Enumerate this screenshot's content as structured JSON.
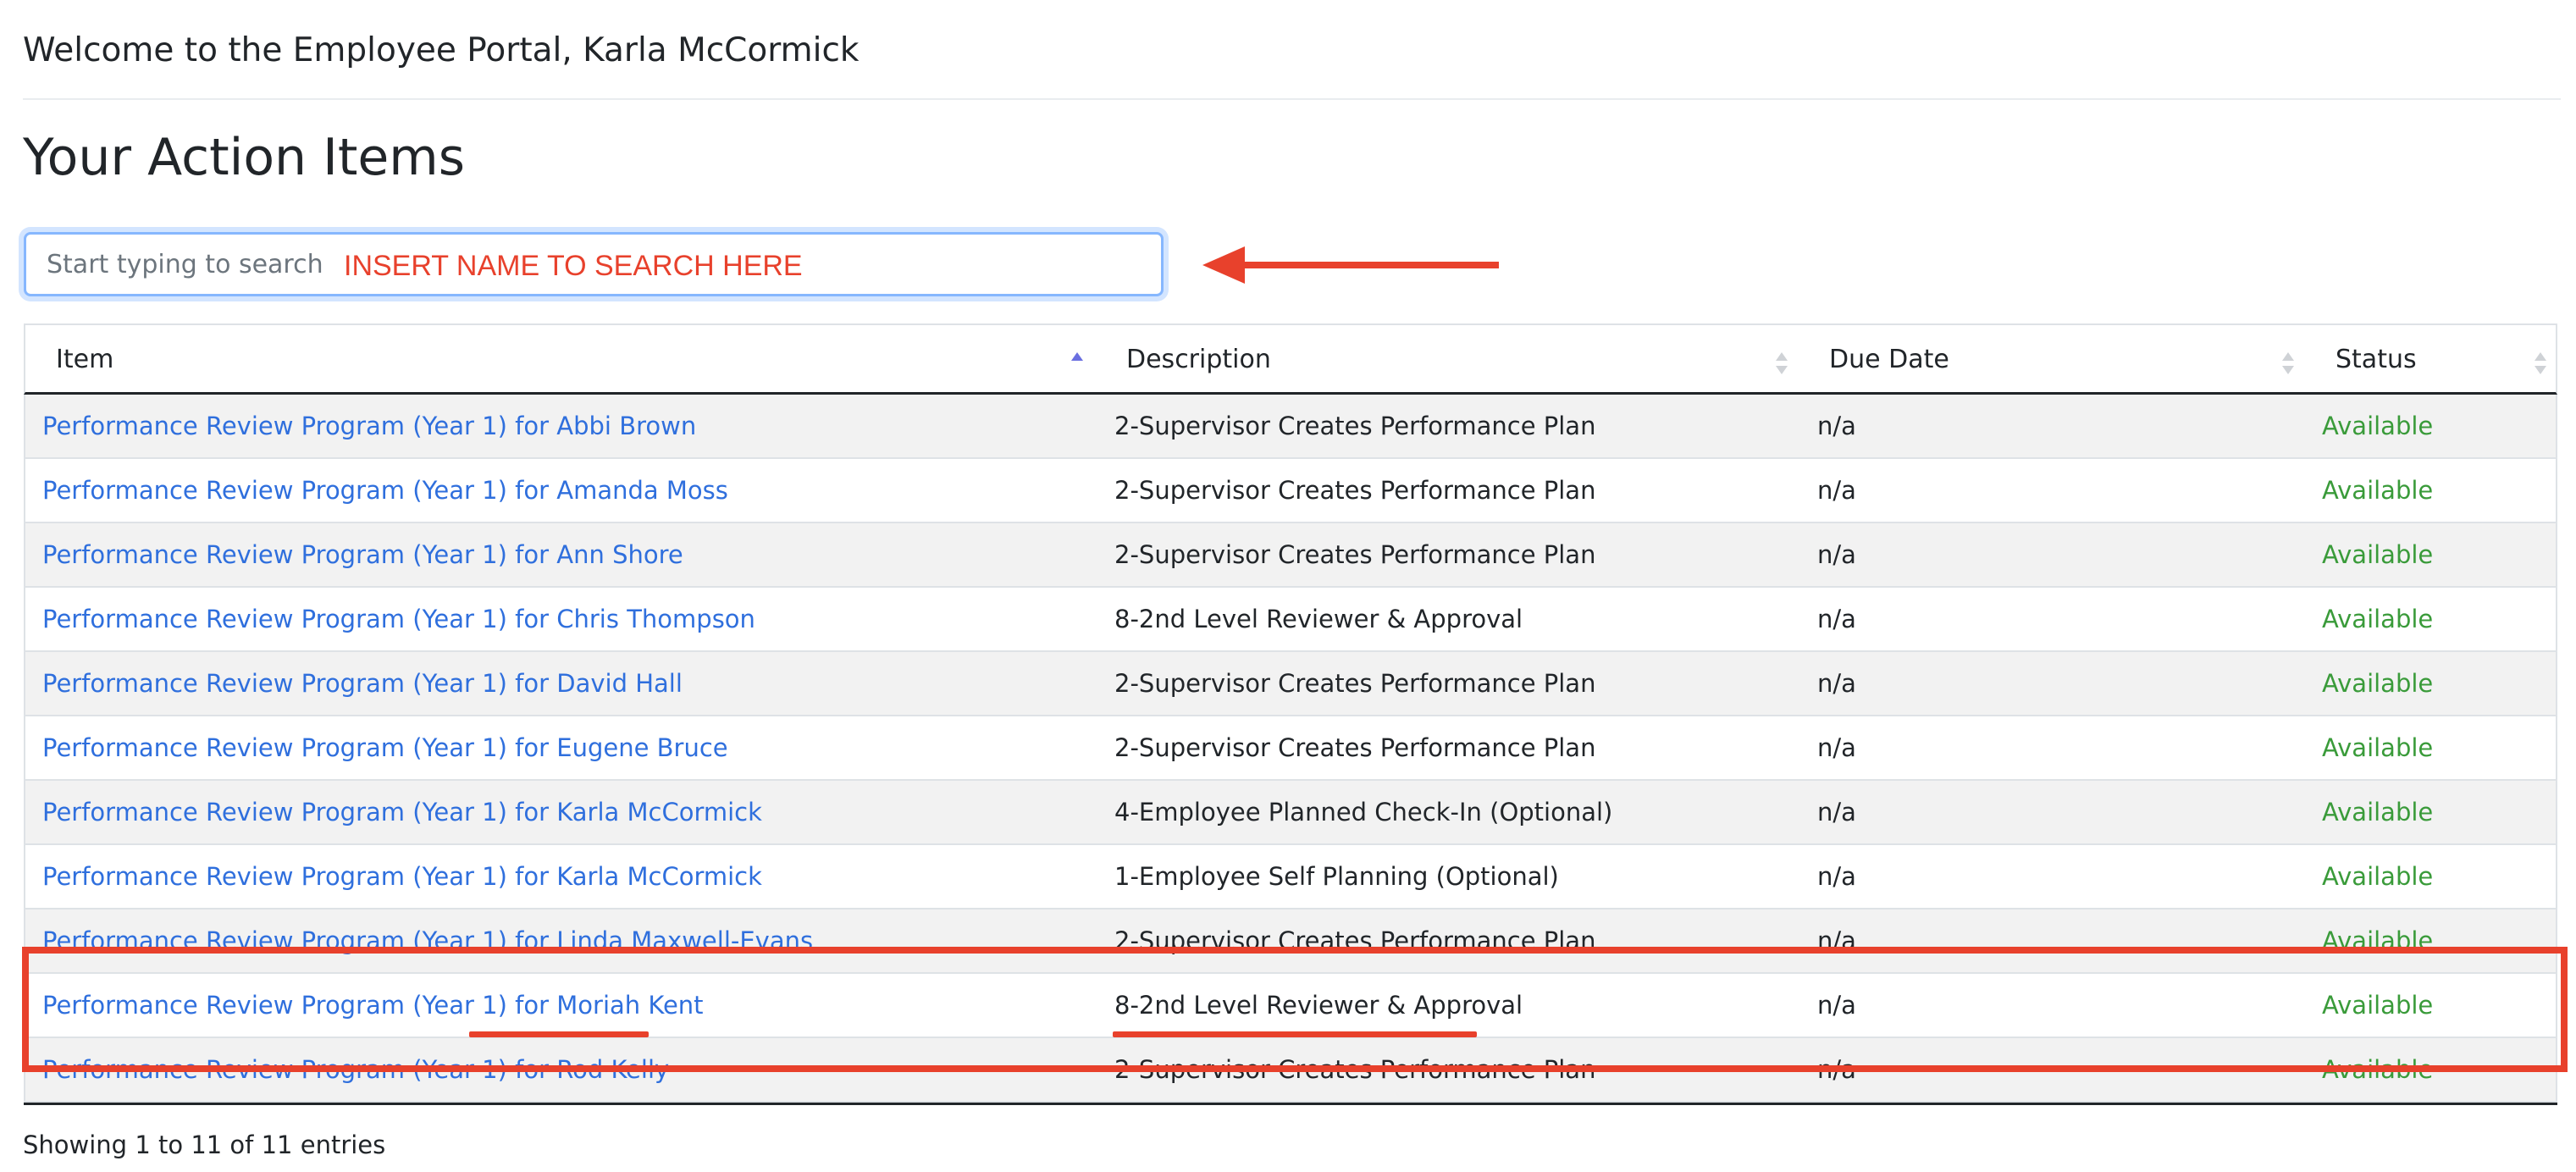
{
  "header": {
    "welcome": "Welcome to the Employee Portal, Karla McCormick",
    "page_title": "Your Action Items"
  },
  "search": {
    "placeholder": "Start typing to search",
    "value": ""
  },
  "annotation": {
    "note": "INSERT NAME TO SEARCH HERE",
    "color": "#e8412c"
  },
  "table": {
    "columns": [
      "Item",
      "Description",
      "Due Date",
      "Status"
    ],
    "sorted_column": "Item",
    "sort_direction": "asc",
    "rows": [
      {
        "item": "Performance Review Program (Year 1) for Abbi Brown",
        "description": "2-Supervisor Creates Performance Plan",
        "due": "n/a",
        "status": "Available"
      },
      {
        "item": "Performance Review Program (Year 1) for Amanda Moss",
        "description": "2-Supervisor Creates Performance Plan",
        "due": "n/a",
        "status": "Available"
      },
      {
        "item": "Performance Review Program (Year 1) for Ann Shore",
        "description": "2-Supervisor Creates Performance Plan",
        "due": "n/a",
        "status": "Available"
      },
      {
        "item": "Performance Review Program (Year 1) for Chris Thompson",
        "description": "8-2nd Level Reviewer & Approval",
        "due": "n/a",
        "status": "Available"
      },
      {
        "item": "Performance Review Program (Year 1) for David Hall",
        "description": "2-Supervisor Creates Performance Plan",
        "due": "n/a",
        "status": "Available"
      },
      {
        "item": "Performance Review Program (Year 1) for Eugene Bruce",
        "description": "2-Supervisor Creates Performance Plan",
        "due": "n/a",
        "status": "Available"
      },
      {
        "item": "Performance Review Program (Year 1) for Karla McCormick",
        "description": "4-Employee Planned Check-In (Optional)",
        "due": "n/a",
        "status": "Available"
      },
      {
        "item": "Performance Review Program (Year 1) for Karla McCormick",
        "description": "1-Employee Self Planning (Optional)",
        "due": "n/a",
        "status": "Available"
      },
      {
        "item": "Performance Review Program (Year 1) for Linda Maxwell-Evans",
        "description": "2-Supervisor Creates Performance Plan",
        "due": "n/a",
        "status": "Available"
      },
      {
        "item": "Performance Review Program (Year 1) for Moriah Kent",
        "description": "8-2nd Level Reviewer & Approval",
        "due": "n/a",
        "status": "Available"
      },
      {
        "item": "Performance Review Program (Year 1) for Rod Kelly",
        "description": "2-Supervisor Creates Performance Plan",
        "due": "n/a",
        "status": "Available"
      }
    ]
  },
  "footer": {
    "info": "Showing 1 to 11 of 11 entries"
  },
  "colors": {
    "link": "#2f6fdd",
    "status_available": "#3a9b3a",
    "annotation_red": "#e8412c",
    "focus_border": "#86b7fe"
  }
}
